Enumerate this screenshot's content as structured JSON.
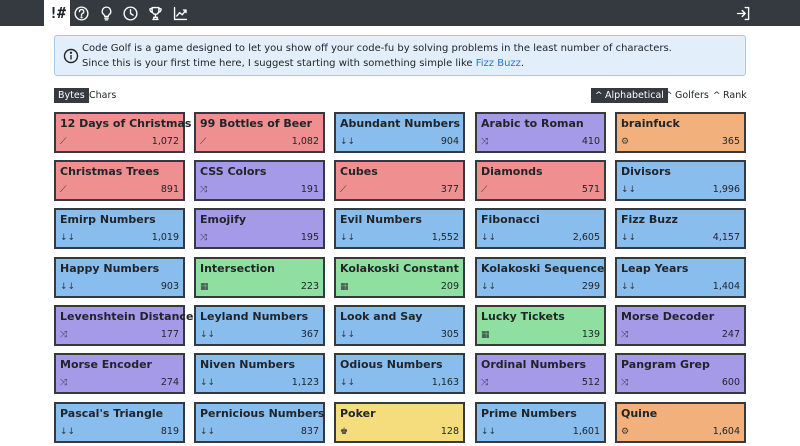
{
  "nav": {
    "logo": "!#",
    "icons": [
      "help-icon",
      "lightbulb-icon",
      "clock-icon",
      "trophy-icon",
      "chart-icon",
      "login-icon"
    ]
  },
  "notice": {
    "line1": "Code Golf is a game designed to let you show off your code-fu by solving problems in the least number of characters.",
    "line2_prefix": "Since this is your first time here, I suggest starting with something simple like ",
    "link": "Fizz Buzz",
    "line2_suffix": "."
  },
  "scoring": {
    "bytes": "Bytes",
    "chars": "Chars",
    "active": "bytes"
  },
  "sorting": {
    "alphabetical": "Alphabetical",
    "golfers": "Golfers",
    "rank": "Rank",
    "caret": "^",
    "active": "alphabetical"
  },
  "colors": {
    "red": "#ef8f8f",
    "blue": "#89bdee",
    "purple": "#a49ae8",
    "orange": "#f2b07c",
    "green": "#8fdfa0",
    "yellow": "#f5dd7e"
  },
  "holes": [
    {
      "name": "12 Days of Christmas",
      "count": "1,072",
      "color": "red",
      "icon": "⟋"
    },
    {
      "name": "99 Bottles of Beer",
      "count": "1,082",
      "color": "red",
      "icon": "⟋"
    },
    {
      "name": "Abundant Numbers",
      "count": "904",
      "color": "blue",
      "icon": "↓↓"
    },
    {
      "name": "Arabic to Roman",
      "count": "410",
      "color": "purple",
      "icon": "⤨"
    },
    {
      "name": "brainfuck",
      "count": "365",
      "color": "orange",
      "icon": "⚙"
    },
    {
      "name": "Christmas Trees",
      "count": "891",
      "color": "red",
      "icon": "⟋"
    },
    {
      "name": "CSS Colors",
      "count": "191",
      "color": "purple",
      "icon": "⤨"
    },
    {
      "name": "Cubes",
      "count": "377",
      "color": "red",
      "icon": "⟋"
    },
    {
      "name": "Diamonds",
      "count": "571",
      "color": "red",
      "icon": "⟋"
    },
    {
      "name": "Divisors",
      "count": "1,996",
      "color": "blue",
      "icon": "↓↓"
    },
    {
      "name": "Emirp Numbers",
      "count": "1,019",
      "color": "blue",
      "icon": "↓↓"
    },
    {
      "name": "Emojify",
      "count": "195",
      "color": "purple",
      "icon": "⤨"
    },
    {
      "name": "Evil Numbers",
      "count": "1,552",
      "color": "blue",
      "icon": "↓↓"
    },
    {
      "name": "Fibonacci",
      "count": "2,605",
      "color": "blue",
      "icon": "↓↓"
    },
    {
      "name": "Fizz Buzz",
      "count": "4,157",
      "color": "blue",
      "icon": "↓↓"
    },
    {
      "name": "Happy Numbers",
      "count": "903",
      "color": "blue",
      "icon": "↓↓"
    },
    {
      "name": "Intersection",
      "count": "223",
      "color": "green",
      "icon": "▦"
    },
    {
      "name": "Kolakoski Constant",
      "count": "209",
      "color": "green",
      "icon": "▦"
    },
    {
      "name": "Kolakoski Sequence",
      "count": "299",
      "color": "blue",
      "icon": "↓↓"
    },
    {
      "name": "Leap Years",
      "count": "1,404",
      "color": "blue",
      "icon": "↓↓"
    },
    {
      "name": "Levenshtein Distance",
      "count": "177",
      "color": "purple",
      "icon": "⤨"
    },
    {
      "name": "Leyland Numbers",
      "count": "367",
      "color": "blue",
      "icon": "↓↓"
    },
    {
      "name": "Look and Say",
      "count": "305",
      "color": "blue",
      "icon": "↓↓"
    },
    {
      "name": "Lucky Tickets",
      "count": "139",
      "color": "green",
      "icon": "▦"
    },
    {
      "name": "Morse Decoder",
      "count": "247",
      "color": "purple",
      "icon": "⤨"
    },
    {
      "name": "Morse Encoder",
      "count": "274",
      "color": "purple",
      "icon": "⤨"
    },
    {
      "name": "Niven Numbers",
      "count": "1,123",
      "color": "blue",
      "icon": "↓↓"
    },
    {
      "name": "Odious Numbers",
      "count": "1,163",
      "color": "blue",
      "icon": "↓↓"
    },
    {
      "name": "Ordinal Numbers",
      "count": "512",
      "color": "purple",
      "icon": "⤨"
    },
    {
      "name": "Pangram Grep",
      "count": "600",
      "color": "purple",
      "icon": "⤨"
    },
    {
      "name": "Pascal's Triangle",
      "count": "819",
      "color": "blue",
      "icon": "↓↓"
    },
    {
      "name": "Pernicious Numbers",
      "count": "837",
      "color": "blue",
      "icon": "↓↓"
    },
    {
      "name": "Poker",
      "count": "128",
      "color": "yellow",
      "icon": "♚"
    },
    {
      "name": "Prime Numbers",
      "count": "1,601",
      "color": "blue",
      "icon": "↓↓"
    },
    {
      "name": "Quine",
      "count": "1,604",
      "color": "orange",
      "icon": "⚙"
    }
  ]
}
